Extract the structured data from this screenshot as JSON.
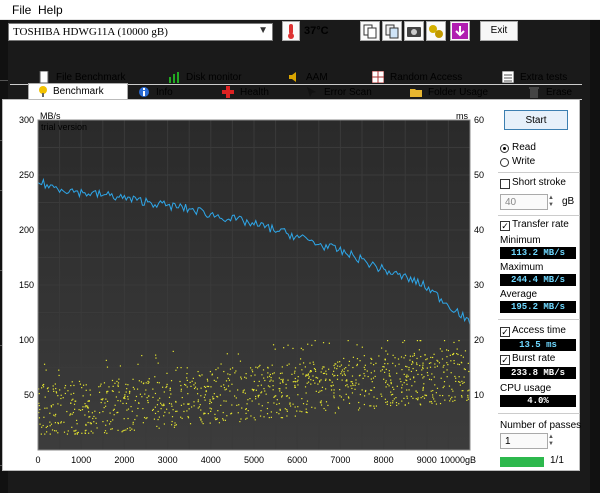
{
  "menu": {
    "file": "File",
    "help": "Help"
  },
  "toolbar": {
    "drive": "TOSHIBA HDWG11A (10000 gB)",
    "temperature": "37°C",
    "exit_label": "Exit"
  },
  "tabs_top": [
    {
      "label": "File Benchmark",
      "icon": "file-icon"
    },
    {
      "label": "Disk monitor",
      "icon": "bar-chart-icon"
    },
    {
      "label": "AAM",
      "icon": "speaker-icon"
    },
    {
      "label": "Random Access",
      "icon": "grid-icon"
    },
    {
      "label": "Extra tests",
      "icon": "list-icon"
    }
  ],
  "tabs_bottom": [
    {
      "label": "Benchmark",
      "icon": "gauge-icon"
    },
    {
      "label": "Info",
      "icon": "info-icon"
    },
    {
      "label": "Health",
      "icon": "cross-icon"
    },
    {
      "label": "Error Scan",
      "icon": "cursor-icon"
    },
    {
      "label": "Folder Usage",
      "icon": "folder-icon"
    },
    {
      "label": "Erase",
      "icon": "trash-icon"
    }
  ],
  "controls": {
    "start_label": "Start",
    "read_label": "Read",
    "write_label": "Write",
    "short_stroke_label": "Short stroke",
    "short_stroke_value": "40",
    "short_stroke_unit": "gB",
    "transfer_rate_label": "Transfer rate",
    "minimum_label": "Minimum",
    "minimum_value": "113.2 MB/s",
    "maximum_label": "Maximum",
    "maximum_value": "244.4 MB/s",
    "average_label": "Average",
    "average_value": "195.2 MB/s",
    "access_time_label": "Access time",
    "access_time_value": "13.5 ms",
    "burst_rate_label": "Burst rate",
    "burst_rate_value": "233.8 MB/s",
    "cpu_usage_label": "CPU usage",
    "cpu_usage_value": "4.0%",
    "passes_label": "Number of passes",
    "passes_value": "1",
    "progress_label": "1/1",
    "progress_fraction": 1.0
  },
  "chart_data": {
    "type": "line",
    "watermark": "trial version",
    "y_left_label": "MB/s",
    "y_right_label": "ms",
    "x_unit": "gB",
    "ylim_left": [
      0,
      300
    ],
    "ylim_right": [
      0,
      60
    ],
    "xlim": [
      0,
      10000
    ],
    "x_ticks": [
      0,
      1000,
      2000,
      3000,
      4000,
      5000,
      6000,
      7000,
      8000,
      9000,
      10000
    ],
    "y_left_ticks": [
      50,
      100,
      150,
      200,
      250,
      300
    ],
    "y_right_ticks": [
      10,
      20,
      30,
      40,
      50,
      60
    ],
    "colors": {
      "background": "#000000",
      "grid": "#3a3a3a",
      "transfer": "#2ea6e8",
      "access": "#e8e830"
    },
    "series": [
      {
        "name": "Transfer rate",
        "axis": "left",
        "x": [
          0,
          250,
          500,
          750,
          1000,
          1250,
          1500,
          1750,
          2000,
          2250,
          2500,
          2750,
          3000,
          3250,
          3500,
          3750,
          4000,
          4250,
          4500,
          4750,
          5000,
          5250,
          5500,
          5750,
          6000,
          6250,
          6500,
          6750,
          7000,
          7250,
          7500,
          7750,
          8000,
          8250,
          8500,
          8750,
          9000,
          9250,
          9500,
          9750,
          10000
        ],
        "y": [
          244,
          240,
          238,
          236,
          234,
          233,
          232,
          231,
          229,
          227,
          226,
          224,
          222,
          221,
          219,
          217,
          214,
          212,
          210,
          208,
          205,
          203,
          200,
          197,
          194,
          191,
          187,
          184,
          181,
          177,
          173,
          168,
          164,
          160,
          157,
          153,
          148,
          140,
          132,
          125,
          114
        ]
      }
    ],
    "access_time": {
      "name": "Access time",
      "axis": "right",
      "min_ms": 3,
      "max_ms": 20,
      "average_ms": 13.5
    }
  }
}
